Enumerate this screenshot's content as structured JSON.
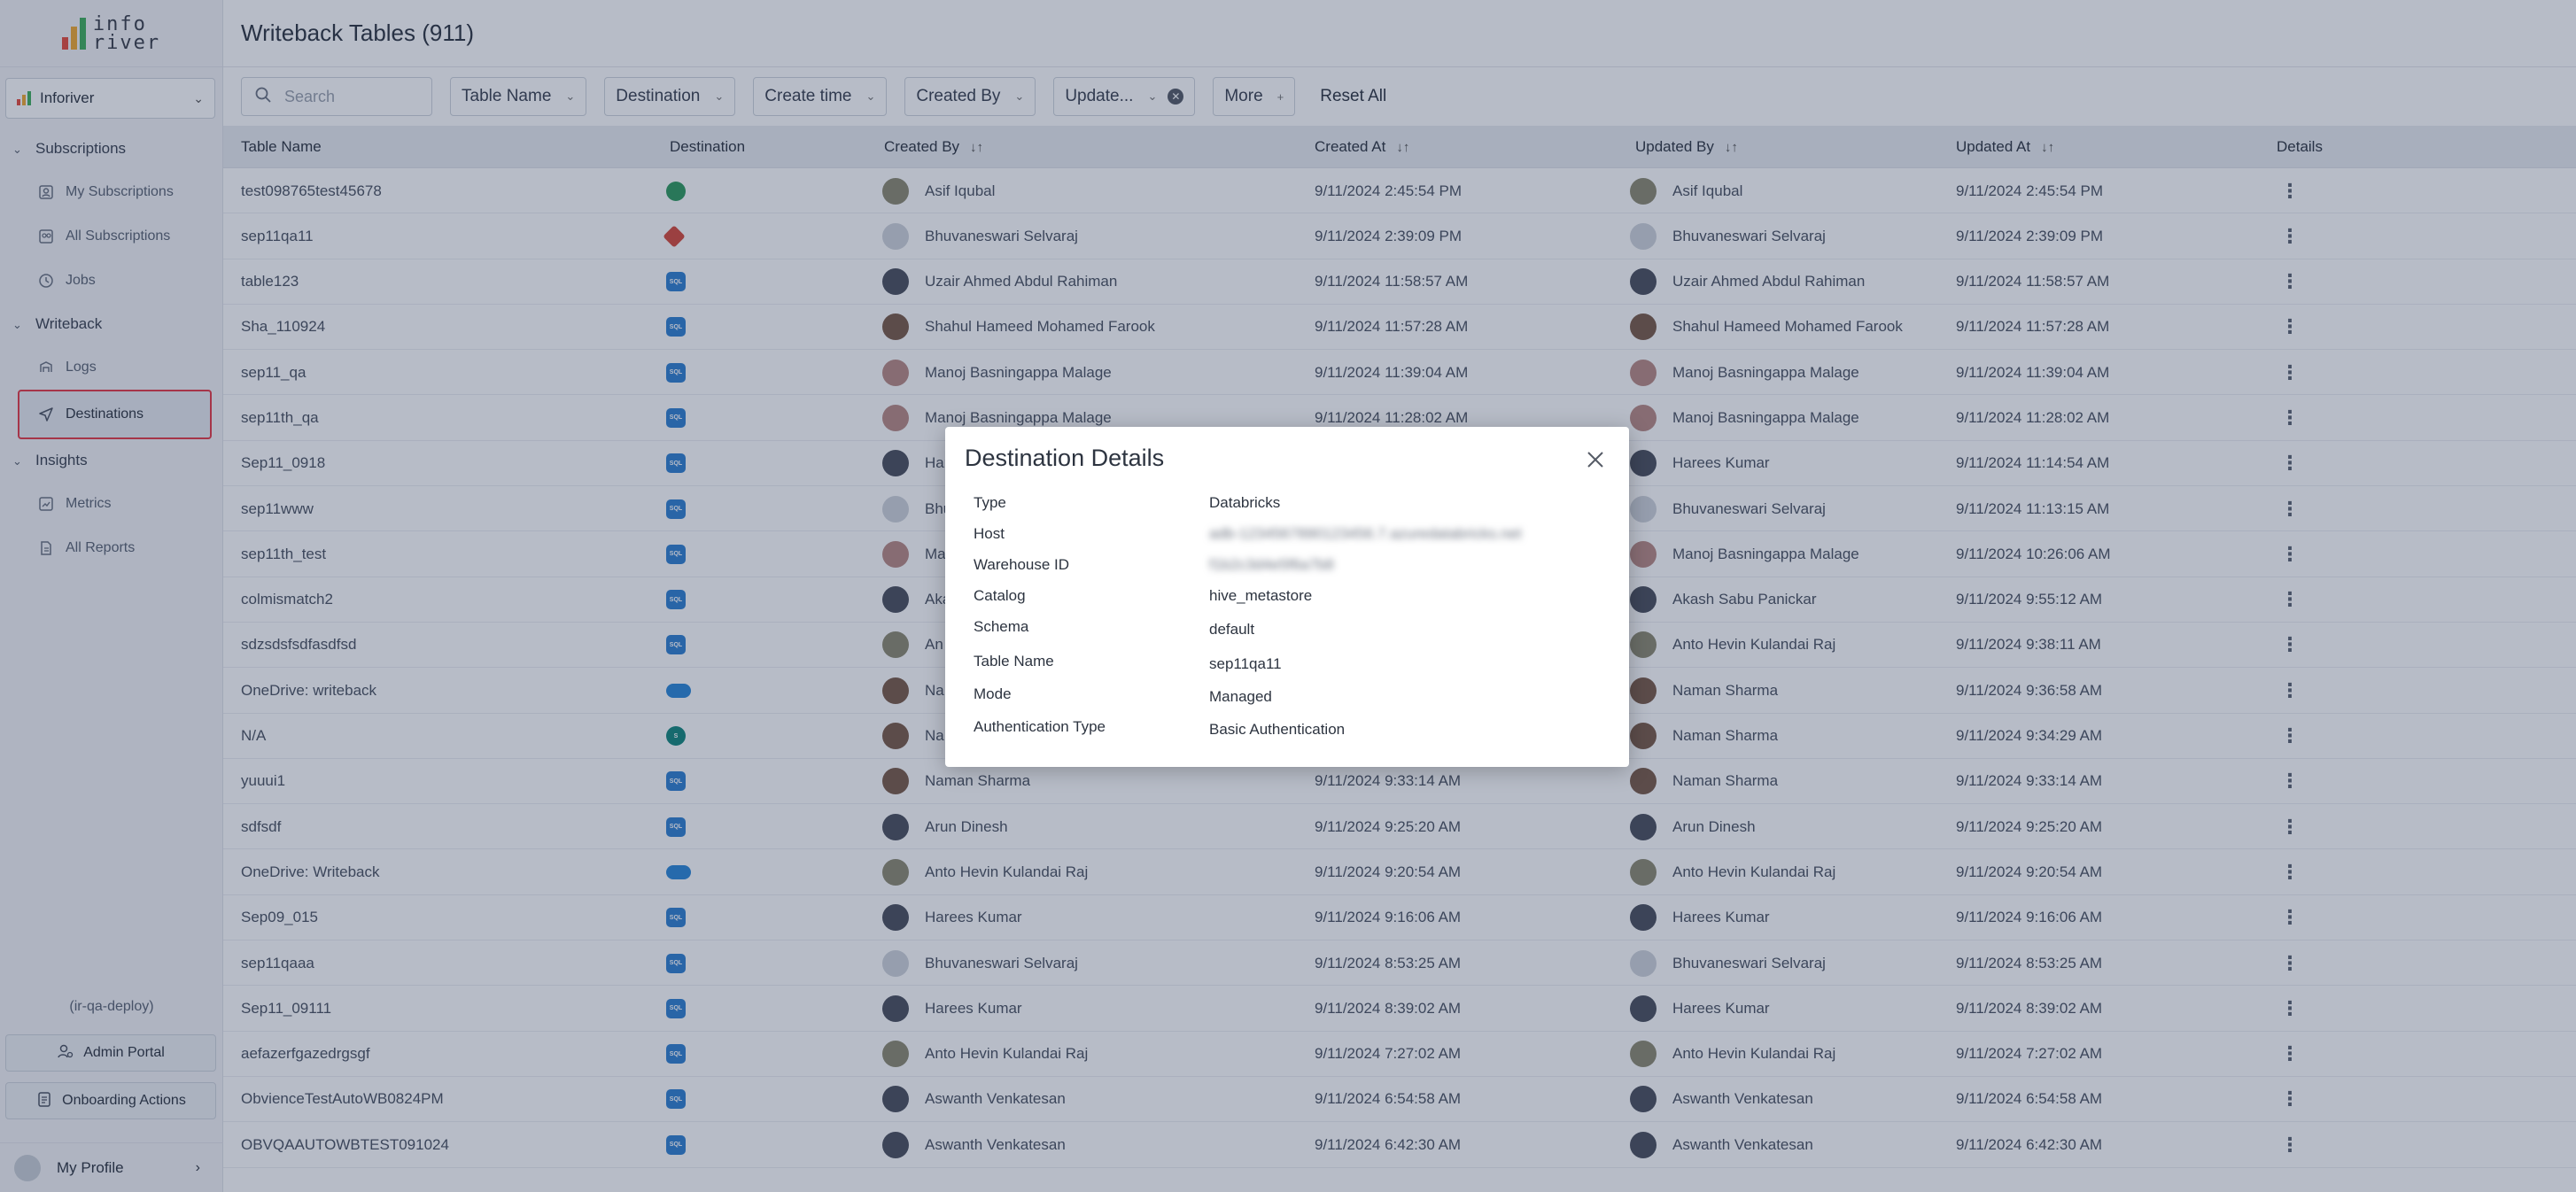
{
  "sidebar": {
    "logo_text_top": "info",
    "logo_text_bottom": "river",
    "app_name": "Inforiver",
    "sections": [
      {
        "label": "Subscriptions",
        "items": [
          {
            "label": "My Subscriptions",
            "icon": "user-icon"
          },
          {
            "label": "All Subscriptions",
            "icon": "users-icon"
          },
          {
            "label": "Jobs",
            "icon": "clock-icon"
          }
        ]
      },
      {
        "label": "Writeback",
        "items": [
          {
            "label": "Logs",
            "icon": "logs-icon"
          },
          {
            "label": "Destinations",
            "icon": "send-icon"
          }
        ]
      },
      {
        "label": "Insights",
        "items": [
          {
            "label": "Metrics",
            "icon": "metrics-icon"
          },
          {
            "label": "All Reports",
            "icon": "report-icon"
          }
        ]
      }
    ],
    "environment": "(ir-qa-deploy)",
    "admin_portal": "Admin Portal",
    "onboarding_actions": "Onboarding Actions",
    "my_profile": "My Profile"
  },
  "header": {
    "title": "Writeback Tables (911)"
  },
  "filters": {
    "search_placeholder": "Search",
    "table_name": "Table Name",
    "destination": "Destination",
    "create_time": "Create time",
    "created_by": "Created By",
    "updated": "Update...",
    "more": "More",
    "reset_all": "Reset All"
  },
  "table": {
    "columns": [
      "Table Name",
      "Destination",
      "Created By",
      "Created At",
      "Updated By",
      "Updated At",
      "Details"
    ],
    "rows": [
      {
        "name": "test098765test45678",
        "dest": "green",
        "created_by": "Asif Iqubal",
        "created_at": "9/11/2024 2:45:54 PM",
        "updated_by": "Asif Iqubal",
        "updated_at": "9/11/2024 2:45:54 PM",
        "av": "khaki"
      },
      {
        "name": "sep11qa11",
        "dest": "red",
        "created_by": "Bhuvaneswari Selvaraj",
        "created_at": "9/11/2024 2:39:09 PM",
        "updated_by": "Bhuvaneswari Selvaraj",
        "updated_at": "9/11/2024 2:39:09 PM",
        "av": "grey"
      },
      {
        "name": "table123",
        "dest": "sql",
        "created_by": "Uzair Ahmed Abdul Rahiman",
        "created_at": "9/11/2024 11:58:57 AM",
        "updated_by": "Uzair Ahmed Abdul Rahiman",
        "updated_at": "9/11/2024 11:58:57 AM",
        "av": "dark"
      },
      {
        "name": "Sha_110924",
        "dest": "sql",
        "created_by": "Shahul Hameed Mohamed Farook",
        "created_at": "9/11/2024 11:57:28 AM",
        "updated_by": "Shahul Hameed Mohamed Farook",
        "updated_at": "9/11/2024 11:57:28 AM",
        "av": "brown"
      },
      {
        "name": "sep11_qa",
        "dest": "sql",
        "created_by": "Manoj Basningappa Malage",
        "created_at": "9/11/2024 11:39:04 AM",
        "updated_by": "Manoj Basningappa Malage",
        "updated_at": "9/11/2024 11:39:04 AM",
        "av": "pink"
      },
      {
        "name": "sep11th_qa",
        "dest": "sql",
        "created_by": "Manoj Basningappa Malage",
        "created_at": "9/11/2024 11:28:02 AM",
        "updated_by": "Manoj Basningappa Malage",
        "updated_at": "9/11/2024 11:28:02 AM",
        "av": "pink"
      },
      {
        "name": "Sep11_0918",
        "dest": "sql",
        "created_by": "Harees Kumar",
        "created_at": "",
        "updated_by": "Harees Kumar",
        "updated_at": "9/11/2024 11:14:54 AM",
        "av": "dark"
      },
      {
        "name": "sep11www",
        "dest": "sql",
        "created_by": "Bhu",
        "created_at": "",
        "updated_by": "Bhuvaneswari Selvaraj",
        "updated_at": "9/11/2024 11:13:15 AM",
        "av": "grey"
      },
      {
        "name": "sep11th_test",
        "dest": "sql",
        "created_by": "Ma",
        "created_at": "",
        "updated_by": "Manoj Basningappa Malage",
        "updated_at": "9/11/2024 10:26:06 AM",
        "av": "pink"
      },
      {
        "name": "colmismatch2",
        "dest": "sql",
        "created_by": "Aka",
        "created_at": "",
        "updated_by": "Akash Sabu Panickar",
        "updated_at": "9/11/2024 9:55:12 AM",
        "av": "dark"
      },
      {
        "name": "sdzsdsfsdfasdfsd",
        "dest": "sql",
        "created_by": "An",
        "created_at": "",
        "updated_by": "Anto Hevin Kulandai Raj",
        "updated_at": "9/11/2024 9:38:11 AM",
        "av": "khaki"
      },
      {
        "name": "OneDrive: writeback",
        "dest": "cloud",
        "created_by": "Na",
        "created_at": "",
        "updated_by": "Naman Sharma",
        "updated_at": "9/11/2024 9:36:58 AM",
        "av": "brown"
      },
      {
        "name": "N/A",
        "dest": "share",
        "created_by": "Na",
        "created_at": "",
        "updated_by": "Naman Sharma",
        "updated_at": "9/11/2024 9:34:29 AM",
        "av": "brown"
      },
      {
        "name": "yuuui1",
        "dest": "sql",
        "created_by": "Naman Sharma",
        "created_at": "9/11/2024 9:33:14 AM",
        "updated_by": "Naman Sharma",
        "updated_at": "9/11/2024 9:33:14 AM",
        "av": "brown"
      },
      {
        "name": "sdfsdf",
        "dest": "sql",
        "created_by": "Arun Dinesh",
        "created_at": "9/11/2024 9:25:20 AM",
        "updated_by": "Arun Dinesh",
        "updated_at": "9/11/2024 9:25:20 AM",
        "av": "dark"
      },
      {
        "name": "OneDrive: Writeback",
        "dest": "cloud",
        "created_by": "Anto Hevin Kulandai Raj",
        "created_at": "9/11/2024 9:20:54 AM",
        "updated_by": "Anto Hevin Kulandai Raj",
        "updated_at": "9/11/2024 9:20:54 AM",
        "av": "khaki"
      },
      {
        "name": "Sep09_015",
        "dest": "sql",
        "created_by": "Harees Kumar",
        "created_at": "9/11/2024 9:16:06 AM",
        "updated_by": "Harees Kumar",
        "updated_at": "9/11/2024 9:16:06 AM",
        "av": "dark"
      },
      {
        "name": "sep11qaaa",
        "dest": "sql",
        "created_by": "Bhuvaneswari Selvaraj",
        "created_at": "9/11/2024 8:53:25 AM",
        "updated_by": "Bhuvaneswari Selvaraj",
        "updated_at": "9/11/2024 8:53:25 AM",
        "av": "grey"
      },
      {
        "name": "Sep11_09111",
        "dest": "sql",
        "created_by": "Harees Kumar",
        "created_at": "9/11/2024 8:39:02 AM",
        "updated_by": "Harees Kumar",
        "updated_at": "9/11/2024 8:39:02 AM",
        "av": "dark"
      },
      {
        "name": "aefazerfgazedrgsgf",
        "dest": "sql",
        "created_by": "Anto Hevin Kulandai Raj",
        "created_at": "9/11/2024 7:27:02 AM",
        "updated_by": "Anto Hevin Kulandai Raj",
        "updated_at": "9/11/2024 7:27:02 AM",
        "av": "khaki"
      },
      {
        "name": "ObvienceTestAutoWB0824PM",
        "dest": "sql",
        "created_by": "Aswanth Venkatesan",
        "created_at": "9/11/2024 6:54:58 AM",
        "updated_by": "Aswanth Venkatesan",
        "updated_at": "9/11/2024 6:54:58 AM",
        "av": "dark"
      },
      {
        "name": "OBVQAAUTOWBTEST091024",
        "dest": "sql",
        "created_by": "Aswanth Venkatesan",
        "created_at": "9/11/2024 6:42:30 AM",
        "updated_by": "Aswanth Venkatesan",
        "updated_at": "9/11/2024 6:42:30 AM",
        "av": "dark"
      }
    ]
  },
  "modal": {
    "title": "Destination Details",
    "fields": [
      {
        "label": "Type",
        "value": "Databricks",
        "blurred": false
      },
      {
        "label": "Host",
        "value": "adb-1234567890123456.7.azuredatabricks.net",
        "blurred": true
      },
      {
        "label": "Warehouse ID",
        "value": "f1b2c3d4e5f6a7b8",
        "blurred": true
      },
      {
        "label": "Catalog",
        "value": "hive_metastore",
        "blurred": false
      },
      {
        "label": "Schema",
        "value": "default",
        "blurred": false
      },
      {
        "label": "Table Name",
        "value": "sep11qa11",
        "blurred": false
      },
      {
        "label": "Mode",
        "value": "Managed",
        "blurred": false
      },
      {
        "label": "Authentication Type",
        "value": "Basic Authentication",
        "blurred": false
      }
    ]
  },
  "colors": {
    "accent_red": "#e63946",
    "sql_blue": "#2f7fd0",
    "overlay": "#1e3050"
  }
}
